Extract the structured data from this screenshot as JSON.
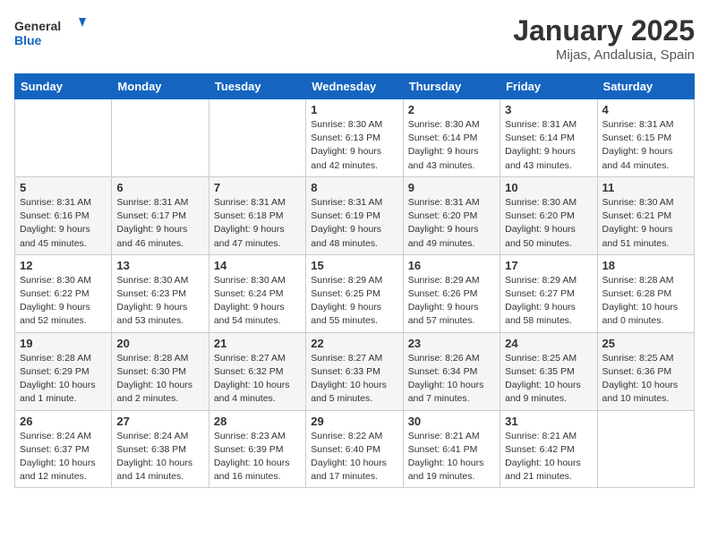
{
  "header": {
    "logo_general": "General",
    "logo_blue": "Blue",
    "title": "January 2025",
    "subtitle": "Mijas, Andalusia, Spain"
  },
  "days_of_week": [
    "Sunday",
    "Monday",
    "Tuesday",
    "Wednesday",
    "Thursday",
    "Friday",
    "Saturday"
  ],
  "weeks": [
    [
      {
        "day": "",
        "info": ""
      },
      {
        "day": "",
        "info": ""
      },
      {
        "day": "",
        "info": ""
      },
      {
        "day": "1",
        "info": "Sunrise: 8:30 AM\nSunset: 6:13 PM\nDaylight: 9 hours and 42 minutes."
      },
      {
        "day": "2",
        "info": "Sunrise: 8:30 AM\nSunset: 6:14 PM\nDaylight: 9 hours and 43 minutes."
      },
      {
        "day": "3",
        "info": "Sunrise: 8:31 AM\nSunset: 6:14 PM\nDaylight: 9 hours and 43 minutes."
      },
      {
        "day": "4",
        "info": "Sunrise: 8:31 AM\nSunset: 6:15 PM\nDaylight: 9 hours and 44 minutes."
      }
    ],
    [
      {
        "day": "5",
        "info": "Sunrise: 8:31 AM\nSunset: 6:16 PM\nDaylight: 9 hours and 45 minutes."
      },
      {
        "day": "6",
        "info": "Sunrise: 8:31 AM\nSunset: 6:17 PM\nDaylight: 9 hours and 46 minutes."
      },
      {
        "day": "7",
        "info": "Sunrise: 8:31 AM\nSunset: 6:18 PM\nDaylight: 9 hours and 47 minutes."
      },
      {
        "day": "8",
        "info": "Sunrise: 8:31 AM\nSunset: 6:19 PM\nDaylight: 9 hours and 48 minutes."
      },
      {
        "day": "9",
        "info": "Sunrise: 8:31 AM\nSunset: 6:20 PM\nDaylight: 9 hours and 49 minutes."
      },
      {
        "day": "10",
        "info": "Sunrise: 8:30 AM\nSunset: 6:20 PM\nDaylight: 9 hours and 50 minutes."
      },
      {
        "day": "11",
        "info": "Sunrise: 8:30 AM\nSunset: 6:21 PM\nDaylight: 9 hours and 51 minutes."
      }
    ],
    [
      {
        "day": "12",
        "info": "Sunrise: 8:30 AM\nSunset: 6:22 PM\nDaylight: 9 hours and 52 minutes."
      },
      {
        "day": "13",
        "info": "Sunrise: 8:30 AM\nSunset: 6:23 PM\nDaylight: 9 hours and 53 minutes."
      },
      {
        "day": "14",
        "info": "Sunrise: 8:30 AM\nSunset: 6:24 PM\nDaylight: 9 hours and 54 minutes."
      },
      {
        "day": "15",
        "info": "Sunrise: 8:29 AM\nSunset: 6:25 PM\nDaylight: 9 hours and 55 minutes."
      },
      {
        "day": "16",
        "info": "Sunrise: 8:29 AM\nSunset: 6:26 PM\nDaylight: 9 hours and 57 minutes."
      },
      {
        "day": "17",
        "info": "Sunrise: 8:29 AM\nSunset: 6:27 PM\nDaylight: 9 hours and 58 minutes."
      },
      {
        "day": "18",
        "info": "Sunrise: 8:28 AM\nSunset: 6:28 PM\nDaylight: 10 hours and 0 minutes."
      }
    ],
    [
      {
        "day": "19",
        "info": "Sunrise: 8:28 AM\nSunset: 6:29 PM\nDaylight: 10 hours and 1 minute."
      },
      {
        "day": "20",
        "info": "Sunrise: 8:28 AM\nSunset: 6:30 PM\nDaylight: 10 hours and 2 minutes."
      },
      {
        "day": "21",
        "info": "Sunrise: 8:27 AM\nSunset: 6:32 PM\nDaylight: 10 hours and 4 minutes."
      },
      {
        "day": "22",
        "info": "Sunrise: 8:27 AM\nSunset: 6:33 PM\nDaylight: 10 hours and 5 minutes."
      },
      {
        "day": "23",
        "info": "Sunrise: 8:26 AM\nSunset: 6:34 PM\nDaylight: 10 hours and 7 minutes."
      },
      {
        "day": "24",
        "info": "Sunrise: 8:25 AM\nSunset: 6:35 PM\nDaylight: 10 hours and 9 minutes."
      },
      {
        "day": "25",
        "info": "Sunrise: 8:25 AM\nSunset: 6:36 PM\nDaylight: 10 hours and 10 minutes."
      }
    ],
    [
      {
        "day": "26",
        "info": "Sunrise: 8:24 AM\nSunset: 6:37 PM\nDaylight: 10 hours and 12 minutes."
      },
      {
        "day": "27",
        "info": "Sunrise: 8:24 AM\nSunset: 6:38 PM\nDaylight: 10 hours and 14 minutes."
      },
      {
        "day": "28",
        "info": "Sunrise: 8:23 AM\nSunset: 6:39 PM\nDaylight: 10 hours and 16 minutes."
      },
      {
        "day": "29",
        "info": "Sunrise: 8:22 AM\nSunset: 6:40 PM\nDaylight: 10 hours and 17 minutes."
      },
      {
        "day": "30",
        "info": "Sunrise: 8:21 AM\nSunset: 6:41 PM\nDaylight: 10 hours and 19 minutes."
      },
      {
        "day": "31",
        "info": "Sunrise: 8:21 AM\nSunset: 6:42 PM\nDaylight: 10 hours and 21 minutes."
      },
      {
        "day": "",
        "info": ""
      }
    ]
  ]
}
